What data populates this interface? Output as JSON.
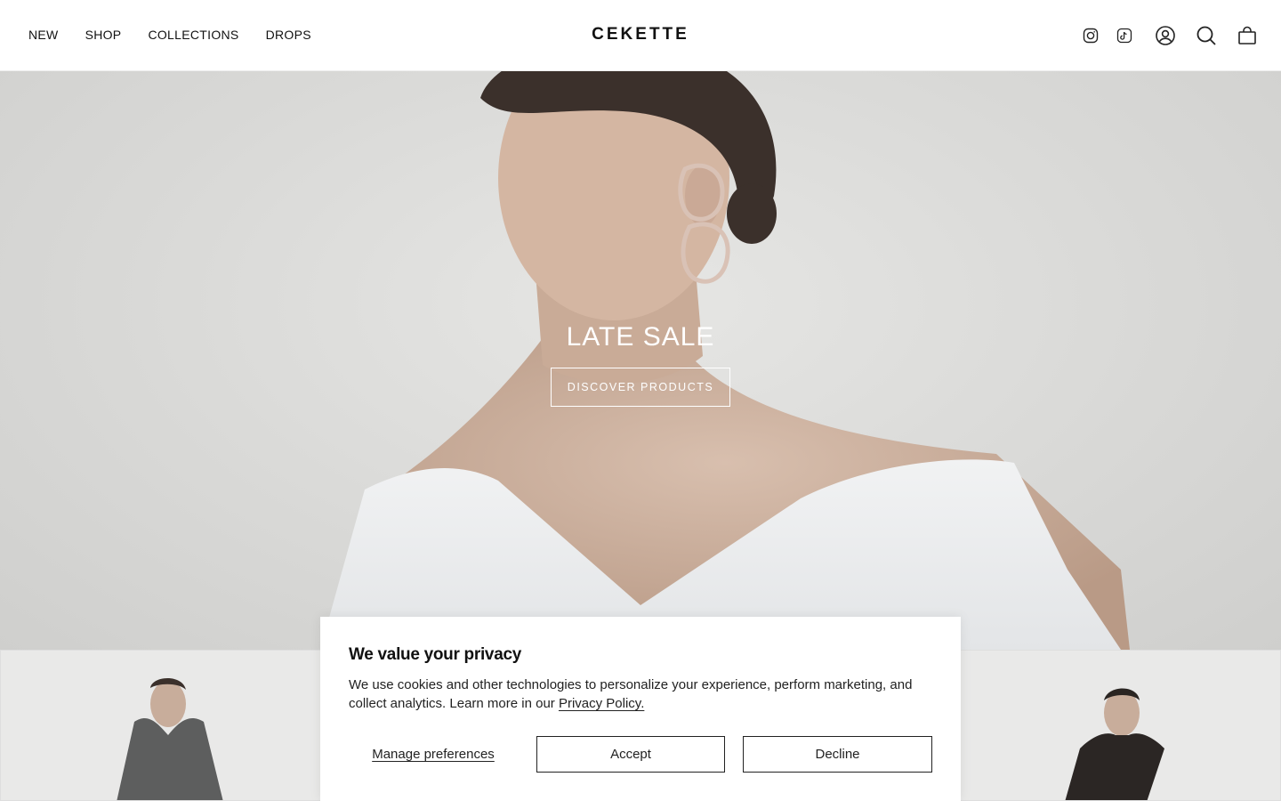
{
  "nav": {
    "items": [
      {
        "label": "NEW"
      },
      {
        "label": "SHOP"
      },
      {
        "label": "COLLECTIONS"
      },
      {
        "label": "DROPS"
      }
    ]
  },
  "brand": {
    "logo": "CEKETTE"
  },
  "header_icons": [
    "instagram-icon",
    "tiktok-icon",
    "account-icon",
    "search-icon",
    "cart-icon"
  ],
  "hero": {
    "title": "LATE SALE",
    "cta_label": "DISCOVER PRODUCTS"
  },
  "cookie_banner": {
    "title": "We value your privacy",
    "body": "We use cookies and other technologies to personalize your experience, perform marketing, and collect analytics. Learn more in our",
    "policy_link": "Privacy Policy.",
    "manage_label": "Manage preferences",
    "accept_label": "Accept",
    "decline_label": "Decline"
  },
  "colors": {
    "text": "#111111",
    "hero_bg": "#dcdcda",
    "banner_bg": "#ffffff"
  }
}
